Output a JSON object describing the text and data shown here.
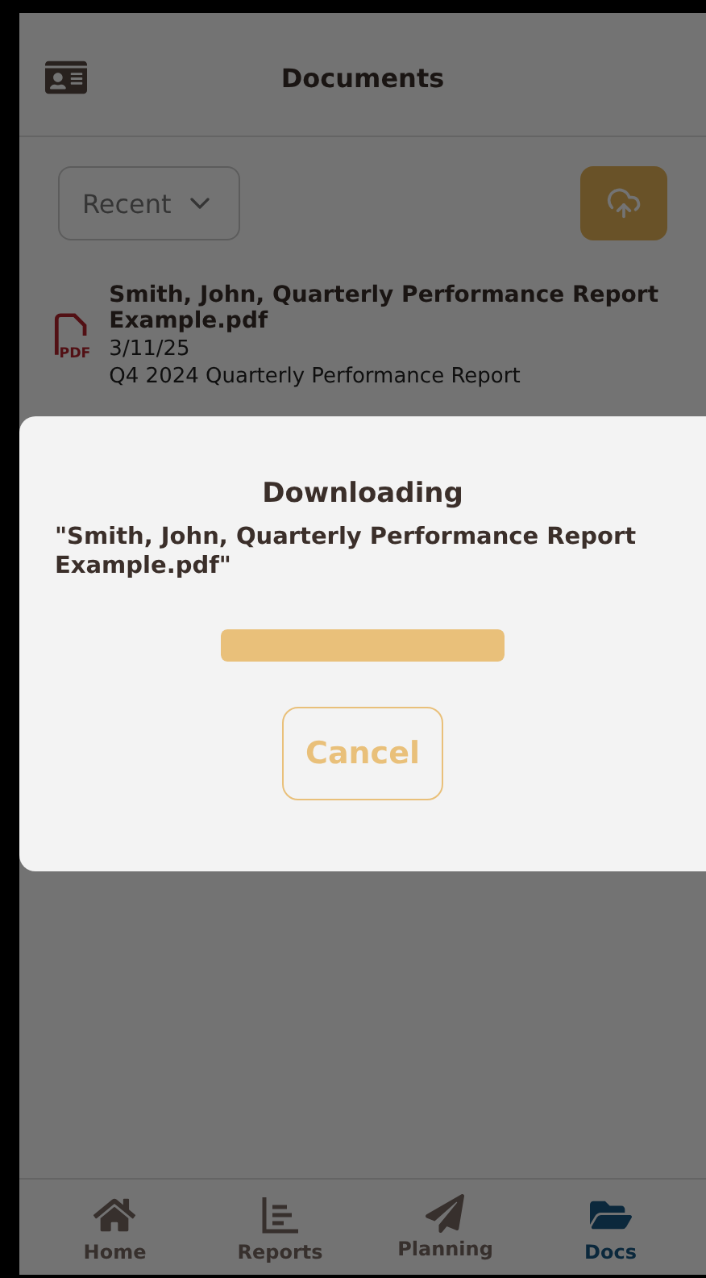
{
  "header": {
    "title": "Documents"
  },
  "filter": {
    "value": "Recent"
  },
  "documents": [
    {
      "name": "Smith, John, Quarterly Performance Report Example.pdf",
      "badge": "PDF",
      "date": "3/11/25",
      "description": "Q4 2024 Quarterly Performance Report"
    }
  ],
  "dialog": {
    "title": "Downloading",
    "message": "\"Smith, John, Quarterly Performance Report Example.pdf\"",
    "progress": {
      "level": 1
    },
    "button": "Cancel"
  },
  "nav": [
    {
      "label": "Home",
      "kind": "home",
      "selected": false
    },
    {
      "label": "Reports",
      "kind": "reports",
      "selected": false
    },
    {
      "label": "Planning",
      "kind": "planning",
      "selected": false
    },
    {
      "label": "Docs",
      "kind": "docs",
      "selected": true
    }
  ]
}
